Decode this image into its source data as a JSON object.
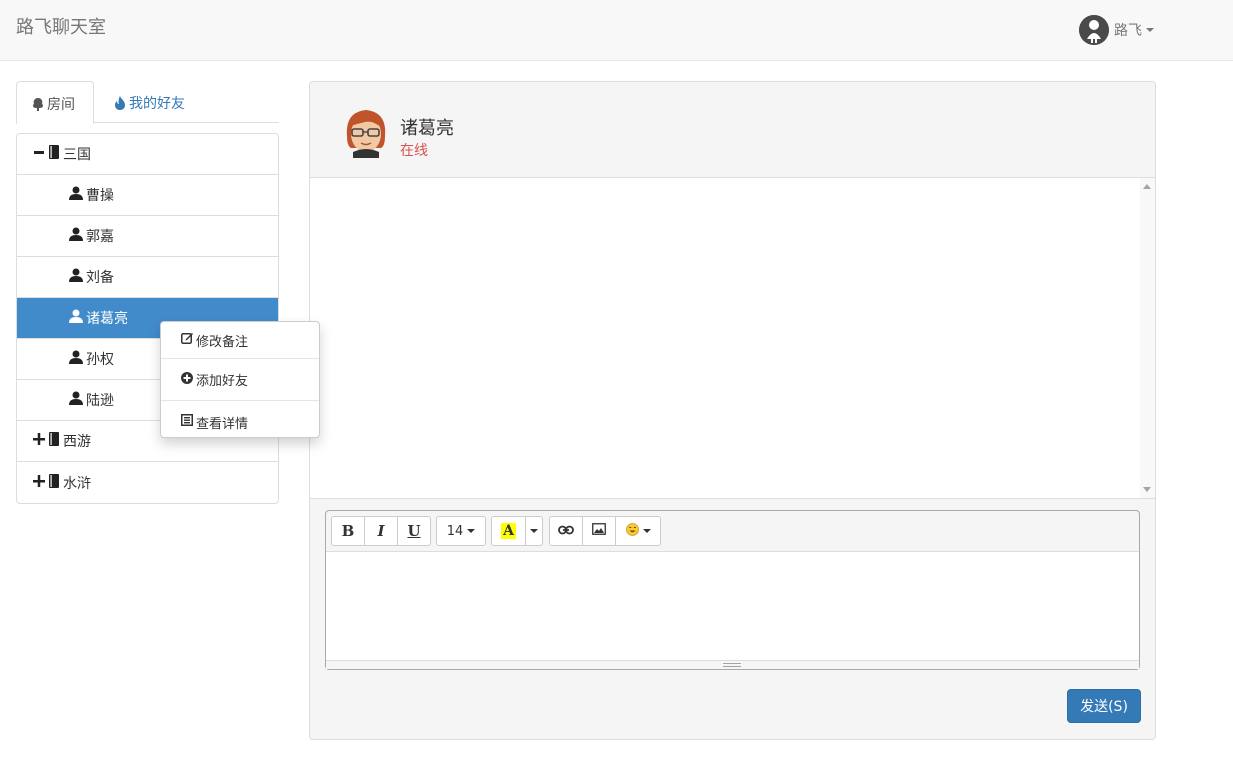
{
  "app": {
    "title": "路飞聊天室"
  },
  "user": {
    "name": "路飞"
  },
  "tabs": [
    {
      "label": "房间",
      "icon": "tree-icon"
    },
    {
      "label": "我的好友",
      "icon": "fire-icon"
    }
  ],
  "tree": {
    "groups": [
      {
        "label": "三国",
        "expanded": true,
        "members": [
          "曹操",
          "郭嘉",
          "刘备",
          "诸葛亮",
          "孙权",
          "陆逊"
        ],
        "selected": "诸葛亮"
      },
      {
        "label": "西游",
        "expanded": false
      },
      {
        "label": "水浒",
        "expanded": false
      }
    ]
  },
  "context_menu": [
    {
      "label": "修改备注",
      "icon": "edit-icon"
    },
    {
      "label": "添加好友",
      "icon": "plus-circle-icon"
    },
    {
      "label": "查看详情",
      "icon": "details-icon"
    }
  ],
  "chat": {
    "contact_name": "诸葛亮",
    "status": "在线",
    "status_color": "#d9534f"
  },
  "editor": {
    "bold": "B",
    "italic": "I",
    "underline": "U",
    "font_size": "14",
    "color_letter": "A",
    "highlight_color": "#ffff00"
  },
  "send_button": {
    "label": "发送(S)",
    "color": "#337ab7"
  }
}
